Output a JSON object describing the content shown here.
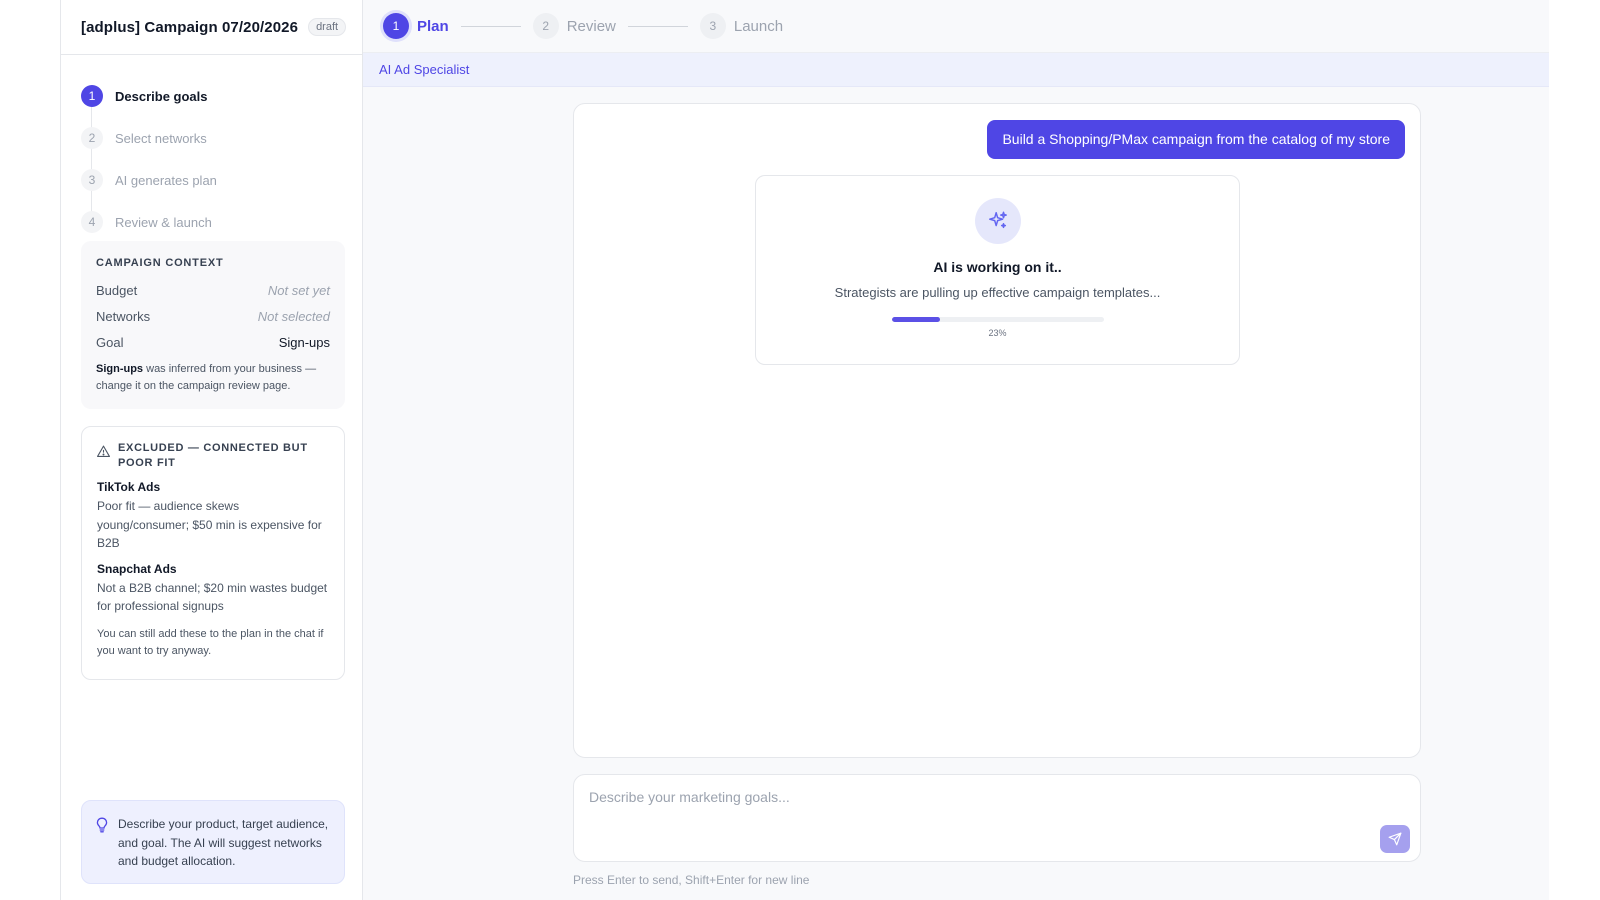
{
  "sidebar": {
    "title": "[adplus] Campaign 07/20/2026",
    "badge": "draft",
    "steps": [
      {
        "num": "1",
        "label": "Describe goals"
      },
      {
        "num": "2",
        "label": "Select networks"
      },
      {
        "num": "3",
        "label": "AI generates plan"
      },
      {
        "num": "4",
        "label": "Review & launch"
      }
    ],
    "context": {
      "title": "CAMPAIGN CONTEXT",
      "rows": [
        {
          "key": "Budget",
          "value": "Not set yet"
        },
        {
          "key": "Networks",
          "value": "Not selected"
        },
        {
          "key": "Goal",
          "value": "Sign-ups"
        }
      ],
      "note_bold": "Sign-ups",
      "note_rest": " was inferred from your business — change it on the campaign review page."
    },
    "excluded": {
      "title": "EXCLUDED — CONNECTED BUT POOR FIT",
      "items": [
        {
          "name": "TikTok Ads",
          "desc": "Poor fit — audience skews young/consumer; $50 min is expensive for B2B"
        },
        {
          "name": "Snapchat Ads",
          "desc": "Not a B2B channel; $20 min wastes budget for professional signups"
        }
      ],
      "footer": "You can still add these to the plan in the chat if you want to try anyway."
    },
    "tip": "Describe your product, target audience, and goal. The AI will suggest networks and budget allocation."
  },
  "topbar": {
    "steps": [
      {
        "num": "1",
        "label": "Plan"
      },
      {
        "num": "2",
        "label": "Review"
      },
      {
        "num": "3",
        "label": "Launch"
      }
    ]
  },
  "specialist": "AI Ad Specialist",
  "chat": {
    "user_message": "Build a Shopping/PMax campaign from the catalog of my store",
    "working": {
      "title": "AI is working on it..",
      "subtitle": "Strategists are pulling up effective campaign templates...",
      "progress": 0.23,
      "progress_label": "23%"
    }
  },
  "composer": {
    "placeholder": "Describe your marketing goals...",
    "hint": "Press Enter to send, Shift+Enter for new line"
  },
  "colors": {
    "accent": "#4f46e5",
    "accent_light": "#eef1fd"
  }
}
